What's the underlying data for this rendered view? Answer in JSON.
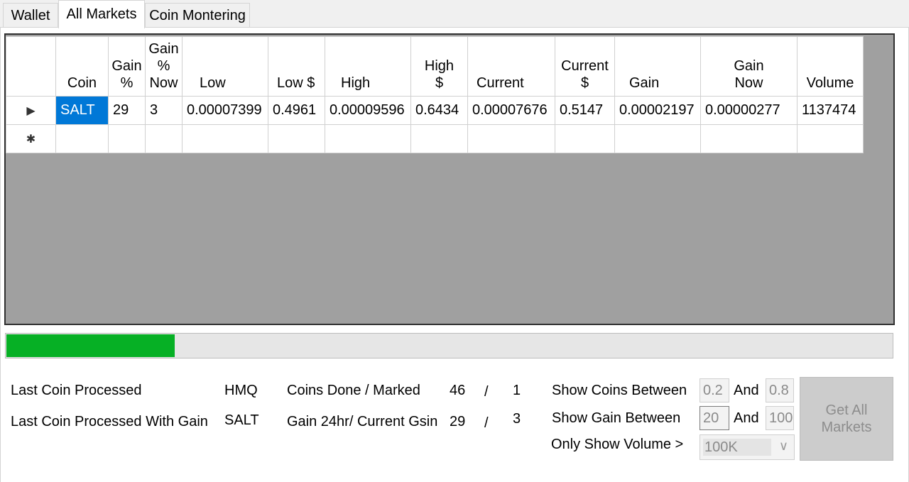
{
  "tabs": [
    {
      "label": "Wallet"
    },
    {
      "label": "All Markets"
    },
    {
      "label": "Coin Montering"
    }
  ],
  "grid": {
    "columns": [
      {
        "label": "Coin"
      },
      {
        "label": "Gain\n%"
      },
      {
        "label": "Gain\n%\nNow"
      },
      {
        "label": "Low"
      },
      {
        "label": "Low $"
      },
      {
        "label": "High"
      },
      {
        "label": "High\n$"
      },
      {
        "label": "Current"
      },
      {
        "label": "Current\n$"
      },
      {
        "label": "Gain"
      },
      {
        "label": "Gain\nNow"
      },
      {
        "label": "Volume"
      }
    ],
    "rows": [
      {
        "marker": "▶",
        "cells": [
          "SALT",
          "29",
          "3",
          "0.00007399",
          "0.4961",
          "0.00009596",
          "0.6434",
          "0.00007676",
          "0.5147",
          "0.00002197",
          "0.00000277",
          "1137474"
        ]
      },
      {
        "marker": "✱",
        "cells": [
          "",
          "",
          "",
          "",
          "",
          "",
          "",
          "",
          "",
          "",
          "",
          ""
        ]
      }
    ]
  },
  "progress": {
    "fraction": 0.19,
    "color": "#06b025"
  },
  "status": {
    "last_coin_label": "Last Coin Processed",
    "last_coin_value": "HMQ",
    "last_gain_label": "Last Coin Processed With Gain",
    "last_gain_value": "SALT",
    "coins_done_label": "Coins Done / Marked",
    "coins_done": "46",
    "coins_sep": "/",
    "coins_marked": "1",
    "gain_label": "Gain 24hr/ Current Gsin",
    "gain_24hr": "29",
    "gain_sep": "/",
    "gain_current": "3"
  },
  "filters": {
    "coins_between_label": "Show Coins Between",
    "coins_min": "0.2",
    "and_label_1": "And",
    "coins_max": "0.8",
    "gain_between_label": "Show Gain Between",
    "gain_min": "20",
    "and_label_2": "And",
    "gain_max": "100",
    "volume_label": "Only Show Volume >",
    "volume_value": "100K"
  },
  "button": {
    "label": "Get All Markets"
  }
}
